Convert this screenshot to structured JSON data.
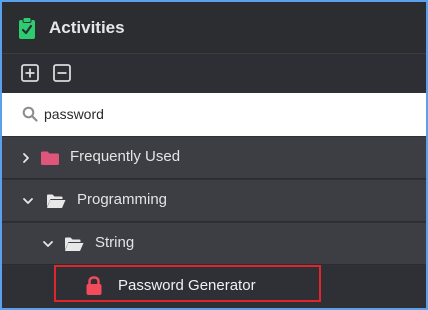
{
  "header": {
    "title": "Activities",
    "icon": "clipboard-check-icon",
    "icon_color": "#2ecc71"
  },
  "toolbar": {
    "expand_all_icon": "plus-square-icon",
    "collapse_all_icon": "minus-square-icon"
  },
  "search": {
    "value": "password",
    "icon": "search-icon"
  },
  "tree": {
    "items": [
      {
        "label": "Frequently Used",
        "expanded": false,
        "folder_color": "#e0557a",
        "chevron": "chevron-right-icon"
      },
      {
        "label": "Programming",
        "expanded": true,
        "folder_color": "#e8e8e8",
        "chevron": "chevron-down-icon"
      },
      {
        "label": "String",
        "expanded": true,
        "folder_color": "#e8e8e8",
        "chevron": "chevron-down-icon"
      },
      {
        "label": "Password Generator",
        "icon": "lock-icon",
        "icon_color": "#f24b5c",
        "highlighted": true
      }
    ]
  },
  "colors": {
    "frame_border": "#5aa0ea",
    "highlight": "#e0262b"
  }
}
